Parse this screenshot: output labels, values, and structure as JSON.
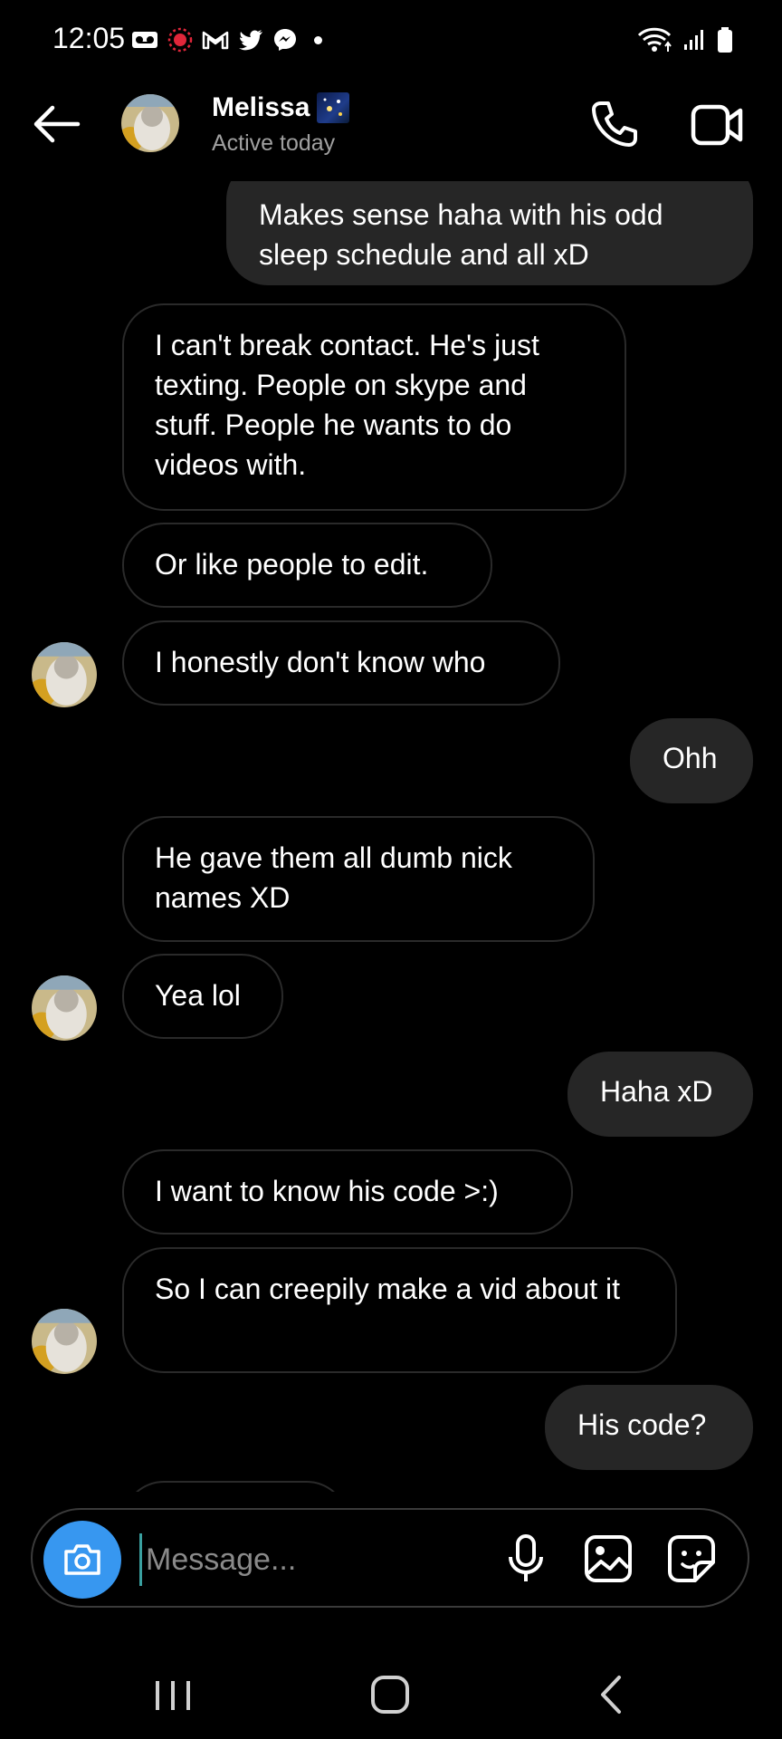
{
  "status_bar": {
    "time": "12:05",
    "left_icons": [
      "voicemail-icon",
      "recording-icon",
      "gmail-icon",
      "twitter-icon",
      "messenger-icon"
    ],
    "right_icons": [
      "wifi-icon",
      "signal-icon",
      "battery-icon"
    ]
  },
  "header": {
    "contact_name": "Melissa",
    "status": "Active today"
  },
  "messages": [
    {
      "dir": "out",
      "text": "Makes sense haha with his odd sleep schedule and all xD"
    },
    {
      "dir": "in",
      "text": "I can't break contact. He's just texting. People on skype and stuff. People he wants to do videos with."
    },
    {
      "dir": "in",
      "text": "Or like people to edit."
    },
    {
      "dir": "in",
      "text": "I honestly don't know who"
    },
    {
      "dir": "out",
      "text": "Ohh"
    },
    {
      "dir": "in",
      "text": "He gave them all dumb nick names XD"
    },
    {
      "dir": "in",
      "text": "Yea lol"
    },
    {
      "dir": "out",
      "text": "Haha xD"
    },
    {
      "dir": "in",
      "text": "I want to know his code >:)"
    },
    {
      "dir": "in",
      "text": "So I can creepily make a vid about it"
    },
    {
      "dir": "out",
      "text": "His code?"
    }
  ],
  "composer": {
    "placeholder": "Message..."
  },
  "colors": {
    "background": "#000000",
    "outgoing_bubble": "#262626",
    "camera_button": "#3797f0"
  }
}
